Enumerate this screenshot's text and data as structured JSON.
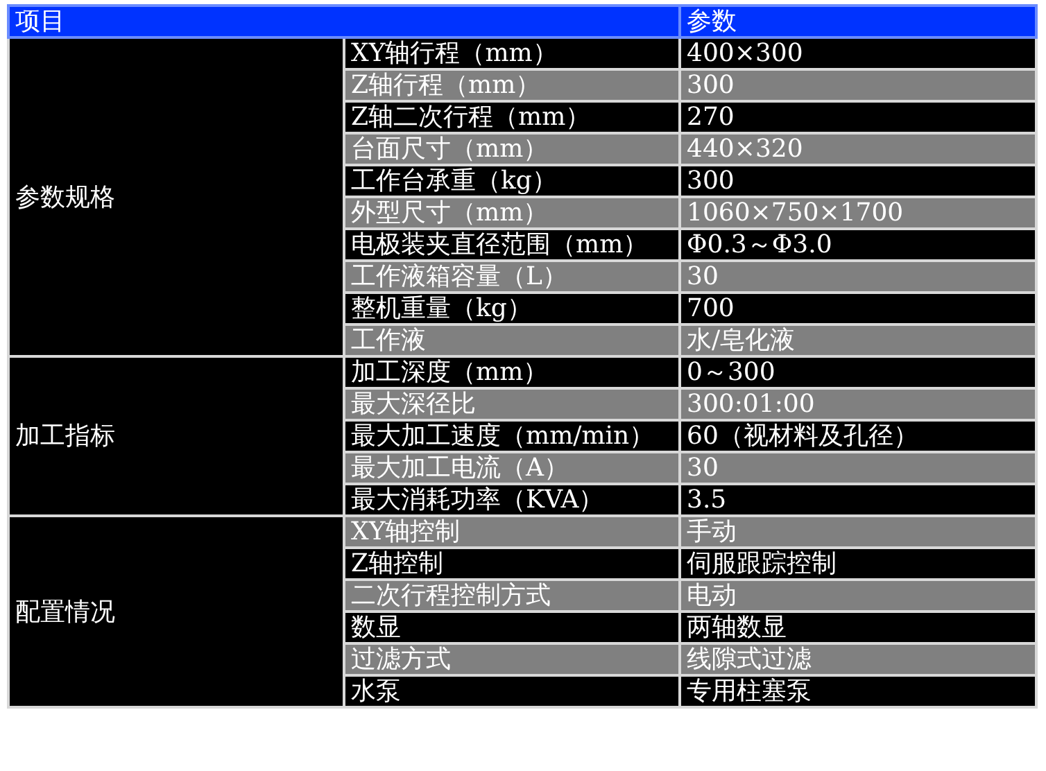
{
  "table": {
    "columns": [
      "项目",
      "参数"
    ],
    "groups": [
      {
        "name": "参数规格",
        "rows": [
          {
            "item": "XY轴行程（mm）",
            "value": "400×300"
          },
          {
            "item": "Z轴行程（mm）",
            "value": "300"
          },
          {
            "item": "Z轴二次行程（mm）",
            "value": "270"
          },
          {
            "item": "台面尺寸（mm）",
            "value": "440×320"
          },
          {
            "item": "工作台承重（kg）",
            "value": "300"
          },
          {
            "item": "外型尺寸（mm）",
            "value": "1060×750×1700"
          },
          {
            "item": "电极装夹直径范围（mm）",
            "value": "Φ0.3～Φ3.0"
          },
          {
            "item": "工作液箱容量（L）",
            "value": "30"
          },
          {
            "item": "整机重量（kg）",
            "value": "700"
          },
          {
            "item": "工作液",
            "value": "水/皂化液"
          }
        ]
      },
      {
        "name": "加工指标",
        "rows": [
          {
            "item": "加工深度（mm）",
            "value": "0～300"
          },
          {
            "item": "最大深径比",
            "value": "300:01:00"
          },
          {
            "item": "最大加工速度（mm/min）",
            "value": "60（视材料及孔径）"
          },
          {
            "item": "最大加工电流（A）",
            "value": "30"
          },
          {
            "item": "最大消耗功率（KVA）",
            "value": "3.5"
          }
        ]
      },
      {
        "name": "配置情况",
        "rows": [
          {
            "item": "XY轴控制",
            "value": "手动"
          },
          {
            "item": "Z轴控制",
            "value": "伺服跟踪控制"
          },
          {
            "item": "二次行程控制方式",
            "value": "电动"
          },
          {
            "item": "数显",
            "value": "两轴数显"
          },
          {
            "item": "过滤方式",
            "value": "线隙式过滤"
          },
          {
            "item": "水泵",
            "value": "专用柱塞泵"
          }
        ]
      }
    ]
  }
}
